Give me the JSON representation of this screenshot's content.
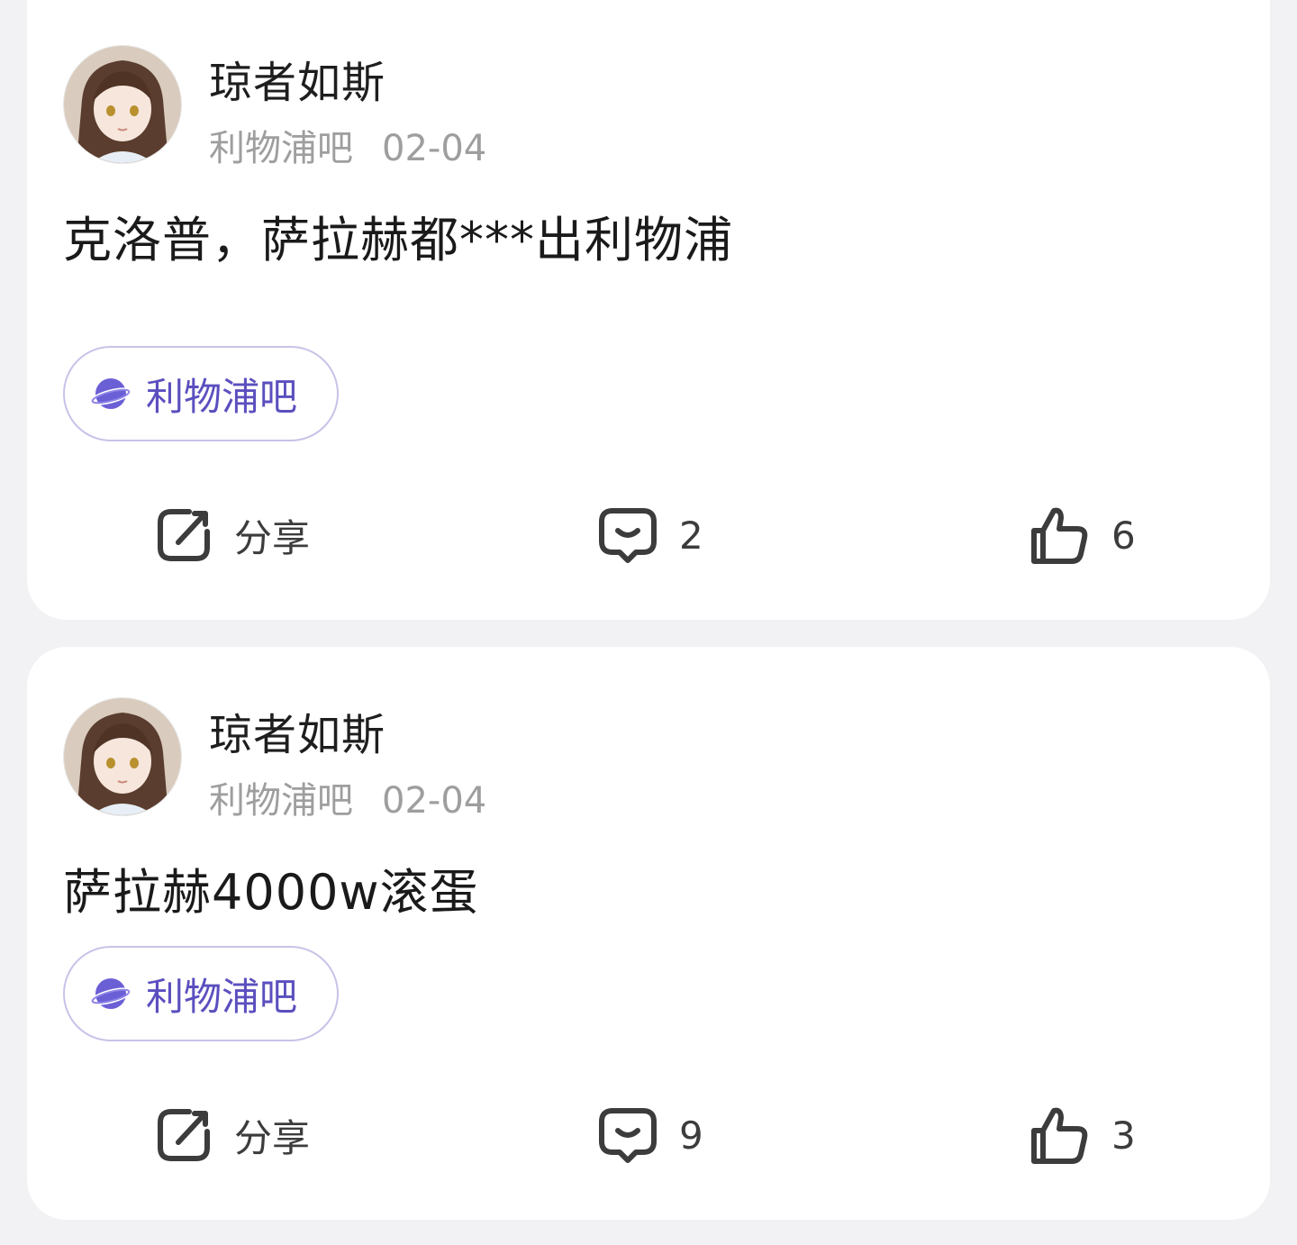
{
  "posts": [
    {
      "author": "琼者如斯",
      "forum": "利物浦吧",
      "date": "02-04",
      "text": "克洛普，萨拉赫都***出利物浦",
      "tag": "利物浦吧",
      "share_label": "分享",
      "comments": "2",
      "likes": "6"
    },
    {
      "author": "琼者如斯",
      "forum": "利物浦吧",
      "date": "02-04",
      "text": "萨拉赫4000w滚蛋",
      "tag": "利物浦吧",
      "share_label": "分享",
      "comments": "9",
      "likes": "3"
    }
  ],
  "icons": {
    "share": "share-icon",
    "comment": "comment-icon",
    "like": "thumbs-up-icon",
    "forum": "planet-icon"
  },
  "colors": {
    "accent": "#5b4fbf",
    "tag_border": "#c9c2e8",
    "meta_gray": "#9e9e9e",
    "background": "#f2f2f4"
  }
}
